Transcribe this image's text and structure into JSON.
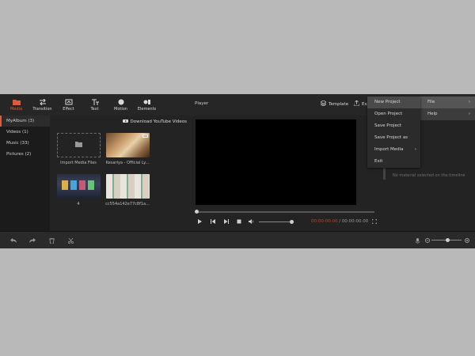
{
  "toolbar": {
    "tabs": [
      {
        "label": "Media",
        "icon": "folder-icon"
      },
      {
        "label": "Transition",
        "icon": "transition-icon"
      },
      {
        "label": "Effect",
        "icon": "effect-icon"
      },
      {
        "label": "Text",
        "icon": "text-icon"
      },
      {
        "label": "Motion",
        "icon": "motion-icon"
      },
      {
        "label": "Elements",
        "icon": "elements-icon"
      }
    ],
    "active_tab": "Media"
  },
  "sidebar": {
    "items": [
      {
        "label": "MyAlbum (3)"
      },
      {
        "label": "Videos (1)"
      },
      {
        "label": "Music (33)"
      },
      {
        "label": "Pictures (2)"
      }
    ]
  },
  "library": {
    "download_label": "Download YouTube Videos",
    "items": [
      {
        "label": "Import Media Files"
      },
      {
        "label": "Kesariya - Official Ly..."
      },
      {
        "label": "4"
      },
      {
        "label": "cc554a142e77c8f1a..."
      }
    ]
  },
  "player": {
    "title": "Player",
    "template_label": "Template",
    "export_label": "Ex",
    "time_current": "00:00:00.00",
    "time_separator": " / ",
    "time_total": "00:00:00.00"
  },
  "right_panel": {
    "empty_text": "No material selected on the timeline"
  },
  "menubar": {
    "items": [
      {
        "label": "File"
      },
      {
        "label": "Help"
      }
    ]
  },
  "file_menu": {
    "items": [
      {
        "label": "New Project"
      },
      {
        "label": "Open Project"
      },
      {
        "label": "Save Project"
      },
      {
        "label": "Save Project as"
      },
      {
        "label": "Import Media"
      },
      {
        "label": "Exit"
      }
    ]
  },
  "colors": {
    "accent": "#e05a3a",
    "time_current": "#c4452d",
    "background": "#1f1f1f"
  }
}
